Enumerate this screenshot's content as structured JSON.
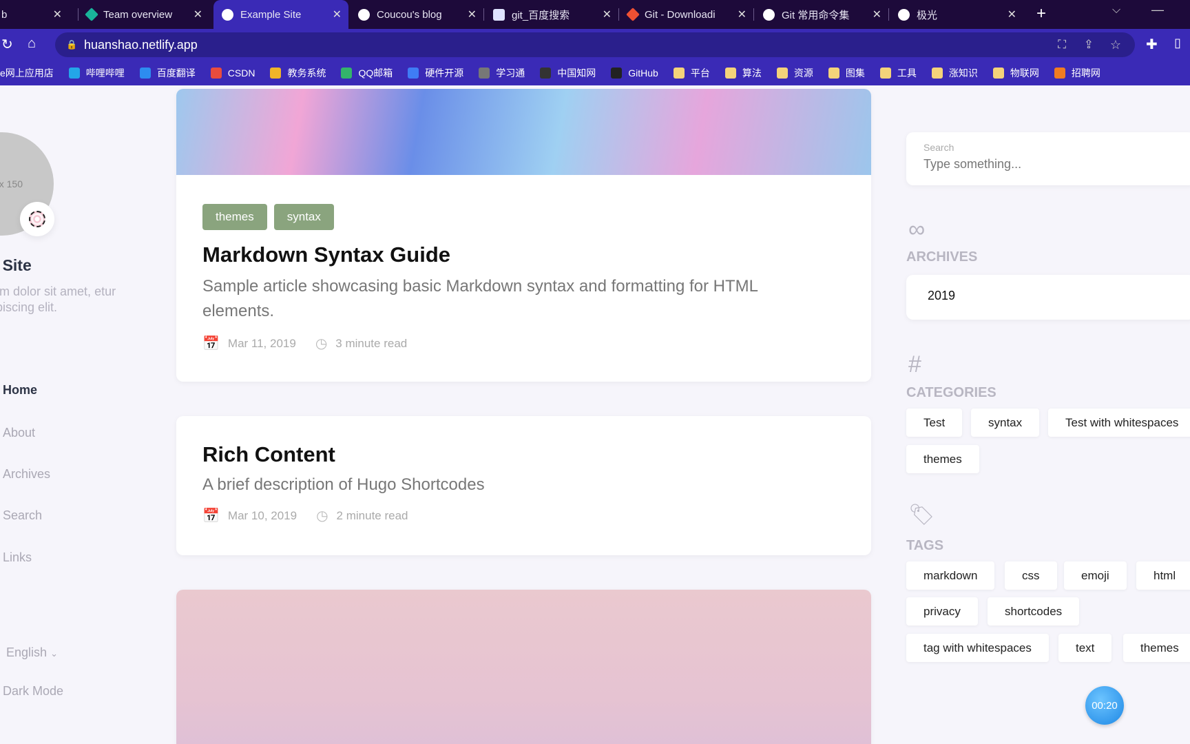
{
  "browser": {
    "tabs": [
      {
        "label": "b"
      },
      {
        "label": "Team overview",
        "icon_color": "#19b39a"
      },
      {
        "label": "Example Site",
        "active": true
      },
      {
        "label": "Coucou's blog"
      },
      {
        "label": "git_百度搜索"
      },
      {
        "label": "Git - Downloadi",
        "icon_color": "#f05033"
      },
      {
        "label": "Git 常用命令集"
      },
      {
        "label": "极光"
      }
    ],
    "url": "huanshao.netlify.app",
    "bookmarks": [
      "e网上应用店",
      "哔哩哔哩",
      "百度翻译",
      "CSDN",
      "教务系统",
      "QQ邮箱",
      "硬件开源",
      "学习通",
      "中国知网",
      "GitHub",
      "平台",
      "算法",
      "资源",
      "图集",
      "工具",
      "涨知识",
      "物联网",
      "招聘网"
    ]
  },
  "profile": {
    "avatar_text": "x 150",
    "site_name": "le Site",
    "description": "psum dolor sit amet, etur adipiscing elit."
  },
  "nav": [
    {
      "label": "Home",
      "active": true
    },
    {
      "label": "About"
    },
    {
      "label": "Archives"
    },
    {
      "label": "Search"
    },
    {
      "label": "Links"
    }
  ],
  "language": "English",
  "dark_mode": "Dark Mode",
  "posts": [
    {
      "tags": [
        "themes",
        "syntax"
      ],
      "title": "Markdown Syntax Guide",
      "description": "Sample article showcasing basic Markdown syntax and formatting for HTML elements.",
      "date": "Mar 11, 2019",
      "read_time": "3 minute read"
    },
    {
      "title": "Rich Content",
      "description": "A brief description of Hugo Shortcodes",
      "date": "Mar 10, 2019",
      "read_time": "2 minute read"
    }
  ],
  "sidebar": {
    "search": {
      "label": "Search",
      "placeholder": "Type something..."
    },
    "archives": {
      "heading": "ARCHIVES",
      "years": [
        "2019"
      ]
    },
    "categories": {
      "heading": "CATEGORIES",
      "items": [
        "Test",
        "syntax",
        "Test with whitespaces",
        "themes"
      ]
    },
    "tags": {
      "heading": "TAGS",
      "items": [
        "markdown",
        "css",
        "emoji",
        "html",
        "privacy",
        "shortcodes",
        "tag with whitespaces",
        "text",
        "themes"
      ]
    }
  },
  "timer": "00:20",
  "colors": {
    "tab_bar": "#1d0a3a",
    "toolbar": "#3a2ab6",
    "tag_green": "#8aa47e",
    "background": "#f6f5fb"
  }
}
